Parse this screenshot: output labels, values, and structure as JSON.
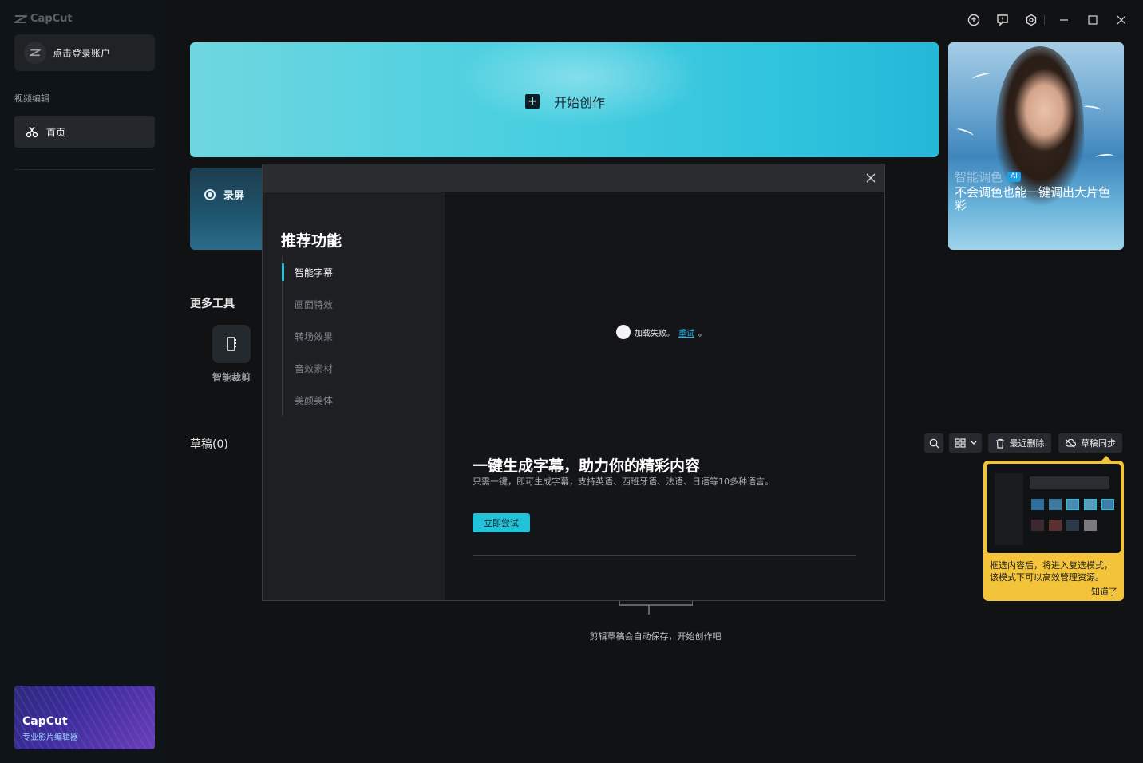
{
  "app": {
    "logo_text": "CapCut"
  },
  "sidebar": {
    "login_label": "点击登录账户",
    "section_label": "视频编辑",
    "home_label": "首页",
    "promo": {
      "title": "CapCut",
      "subtitle": "专业影片编辑器"
    }
  },
  "window_controls": [
    "upload-icon",
    "feedback-icon",
    "settings-icon",
    "minimize-icon",
    "maximize-icon",
    "close-icon"
  ],
  "main": {
    "create_label": "开始创作",
    "record_label": "录屏",
    "feature_card": {
      "tag": "智能调色",
      "badge": "AI",
      "description": "不会调色也能一键调出大片色彩"
    },
    "more_tools_title": "更多工具",
    "tools": [
      {
        "label": "智能裁剪",
        "icon": "smart-crop-icon"
      }
    ],
    "drafts_title": "草稿(0)",
    "toolbar": {
      "recent_delete": "最近删除",
      "draft_sync": "草稿同步"
    },
    "empty_text": "剪辑草稿会自动保存，开始创作吧",
    "tooltip": {
      "text": "框选内容后，将进入复选模式，该模式下可以高效管理资源。",
      "ok": "知道了"
    }
  },
  "modal": {
    "title": "推荐功能",
    "menu": [
      "智能字幕",
      "画面特效",
      "转场效果",
      "音效素材",
      "美颜美体"
    ],
    "active_index": 0,
    "load_fail": "加载失败。",
    "retry": "重试",
    "retry_suffix": "。",
    "heading": "一键生成字幕，助力你的精彩内容",
    "subheading": "只需一键，即可生成字幕，支持英语、西班牙语、法语、日语等10多种语言。",
    "try_button": "立即尝试"
  },
  "colors": {
    "accent": "#22c3d8",
    "tooltip": "#f3c43a",
    "background": "#111214"
  }
}
